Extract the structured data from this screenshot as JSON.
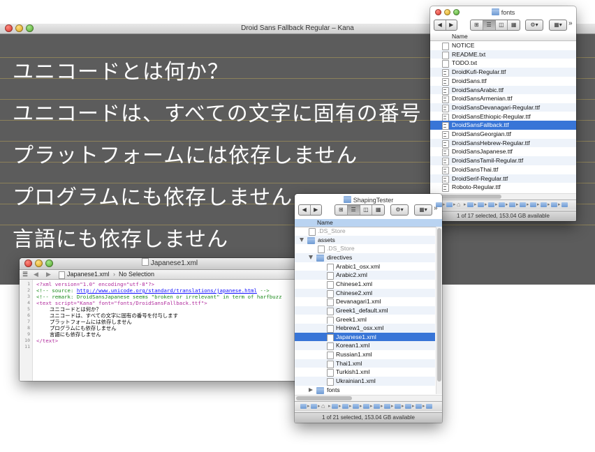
{
  "kana_window": {
    "title": "Droid Sans Fallback Regular – Kana",
    "lines": [
      "ユニコードとは何か？",
      "ユニコードは、すべての文字に固有の番号",
      "プラットフォームには依存しません",
      "プログラムにも依存しません",
      "言語にも依存しません"
    ]
  },
  "editor_window": {
    "title": "Japanese1.xml",
    "jump_file": "Japanese1.xml",
    "jump_selection": "No Selection",
    "line_numbers": [
      "1",
      "2",
      "3",
      "4",
      "5",
      "6",
      "7",
      "8",
      "9",
      "10",
      "11"
    ],
    "code": {
      "l1": "<?xml version=\"1.0\" encoding=\"utf-8\"?>",
      "l2_pre": "<!-- source: ",
      "l2_link": "http://www.unicode.org/standard/translations/japanese.html",
      "l2_post": " -->",
      "l3": "<!-- remark: DroidSansJapanese seems \"broken or irrelevant\" in term of harfbuzz",
      "l4": "<text script=\"Kana\" font=\"fonts/DroidSansFallback.ttf\">",
      "l5": "ユニコードとは何か？",
      "l6": "ユニコードは、すべての文字に固有の番号を付与します",
      "l7": "プラットフォームには依存しません",
      "l8": "プログラムにも依存しません",
      "l9": "言語にも依存しません",
      "l10": "</text>"
    }
  },
  "fonts_window": {
    "title": "fonts",
    "column": "Name",
    "files": [
      "NOTICE",
      "README.txt",
      "TODO.txt",
      "DroidKufi-Regular.ttf",
      "DroidSans.ttf",
      "DroidSansArabic.ttf",
      "DroidSansArmenian.ttf",
      "DroidSansDevanagari-Regular.ttf",
      "DroidSansEthiopic-Regular.ttf",
      "DroidSansFallback.ttf",
      "DroidSansGeorgian.ttf",
      "DroidSansHebrew-Regular.ttf",
      "DroidSansJapanese.ttf",
      "DroidSansTamil-Regular.ttf",
      "DroidSansThai.ttf",
      "DroidSerif-Regular.ttf",
      "Roboto-Regular.ttf"
    ],
    "selected": "DroidSansFallback.ttf",
    "status": "1 of 17 selected, 153.04 GB available"
  },
  "shaping_window": {
    "title": "ShapingTester",
    "column": "Name",
    "rows": [
      ".DS_Store",
      "assets",
      ".DS_Store",
      "directives",
      "Arabic1_osx.xml",
      "Arabic2.xml",
      "Chinese1.xml",
      "Chinese2.xml",
      "Devanagari1.xml",
      "Greek1_default.xml",
      "Greek1.xml",
      "Hebrew1_osx.xml",
      "Japanese1.xml",
      "Korean1.xml",
      "Russian1.xml",
      "Thai1.xml",
      "Turkish1.xml",
      "Ukrainian1.xml",
      "fonts"
    ],
    "selected": "Japanese1.xml",
    "status": "1 of 21 selected, 153.04 GB available"
  },
  "icons": [
    "back-arrow-icon",
    "forward-arrow-icon",
    "icon-view-icon",
    "list-view-icon",
    "column-view-icon",
    "coverflow-icon",
    "gear-icon",
    "arrange-icon",
    "folder-icon",
    "file-icon",
    "font-file-icon",
    "disclosure-triangle-icon",
    "home-icon"
  ],
  "colors": {
    "selection": "#3875d7",
    "kana_background": "#5c5c5c",
    "kana_text": "#ffffff",
    "xml_comment": "#1a8a1a",
    "xml_tag": "#b02a9c",
    "xml_string": "#c41a16",
    "link": "#0e0eff"
  }
}
